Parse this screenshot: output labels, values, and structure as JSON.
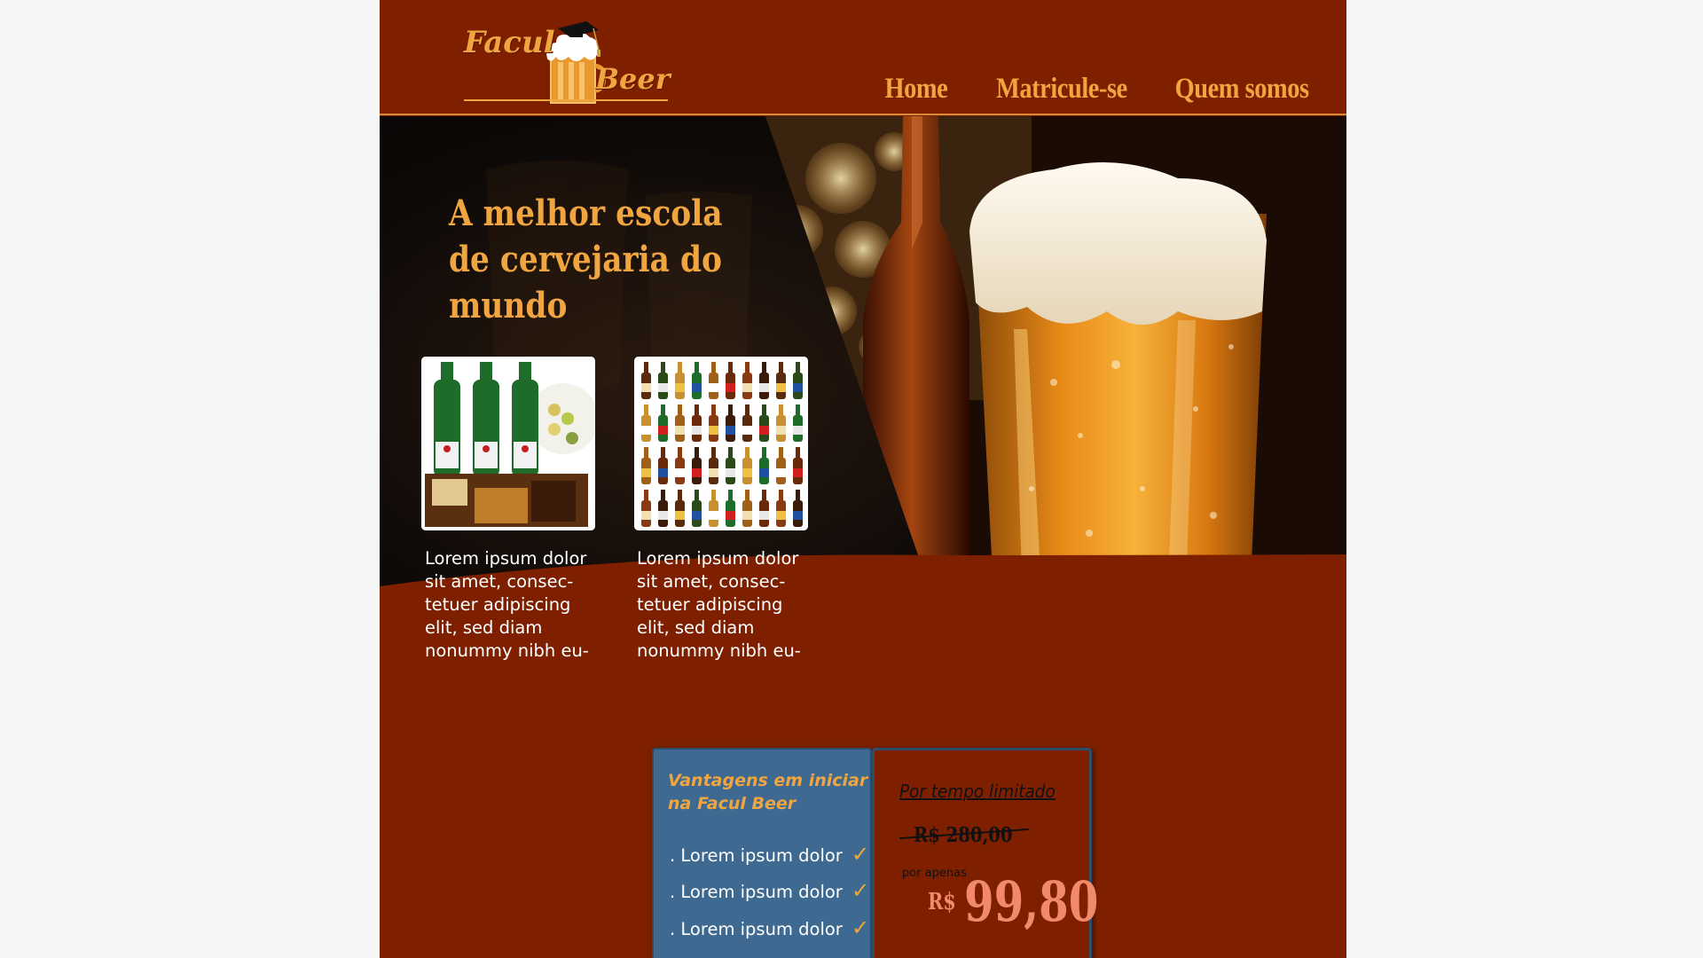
{
  "logo": {
    "word1": "Facul",
    "word2": "Beer"
  },
  "nav": {
    "items": [
      {
        "label": "Home"
      },
      {
        "label": "Matricule-se"
      },
      {
        "label": "Quem somos"
      }
    ]
  },
  "hero": {
    "title": "A melhor escola de cervejaria do mundo",
    "cards": [
      {
        "image": "heineken-bottles-snacks",
        "text": "Lorem ipsum dolor sit amet, consec- tetuer adipiscing elit, sed diam nonummy nibh eu-"
      },
      {
        "image": "beer-bottles-grid",
        "text": "Lorem ipsum dolor sit amet, consec- tetuer adipiscing elit, sed diam nonummy nibh eu-"
      }
    ]
  },
  "advantages": {
    "title": "Vantagens em iniciar na Facul Beer",
    "items": [
      "Lorem ipsum dolor",
      "Lorem ipsum dolor",
      "Lorem ipsum dolor"
    ],
    "bullet": ".",
    "check": "✓"
  },
  "pricing": {
    "limited": "Por tempo limitado",
    "old_price": "R$ 280,00",
    "only": "por apenas",
    "currency": "R$",
    "new_price": "99,80"
  },
  "colors": {
    "brand": "#7e2000",
    "accent": "#f0a540",
    "panel_blue": "#3e6a91",
    "price": "#f08a6a",
    "background": "#f6f6f6"
  }
}
